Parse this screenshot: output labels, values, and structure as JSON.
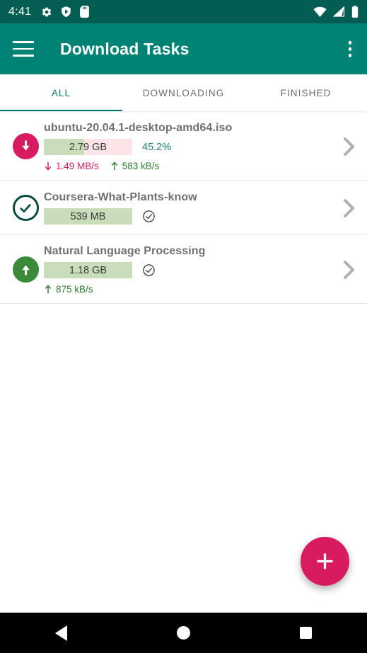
{
  "status_bar": {
    "clock": "4:41",
    "left_icons": [
      "gear-icon",
      "shield-play-icon",
      "sd-card-icon"
    ],
    "right_icons": [
      "wifi-icon",
      "cell-signal-icon",
      "battery-icon"
    ],
    "background": "#035D52"
  },
  "app_bar": {
    "menu_icon": "hamburger-menu-icon",
    "title": "Download Tasks",
    "overflow_icon": "more-vert-icon",
    "background": "#008375"
  },
  "tabs": {
    "active_index": 0,
    "active_color": "#00796B",
    "items": [
      {
        "label": "ALL"
      },
      {
        "label": "DOWNLOADING"
      },
      {
        "label": "FINISHED"
      }
    ]
  },
  "tasks": [
    {
      "name": "ubuntu-20.04.1-desktop-amd64.iso",
      "state_icon": "download-arrow-icon",
      "state_color": "#D81B60",
      "size": "2.79 GB",
      "percent_label": "45.2%",
      "percent_value": 45.2,
      "complete": false,
      "has_check": false,
      "download_speed": "1.49 MB/s",
      "upload_speed": "583 kB/s",
      "chevron_icon": "chevron-right-icon"
    },
    {
      "name": "Coursera-What-Plants-know",
      "state_icon": "check-circle-outline-icon",
      "state_color": "#0B4A42",
      "size": "539 MB",
      "percent_label": "",
      "percent_value": 100,
      "complete": true,
      "has_check": true,
      "download_speed": "",
      "upload_speed": "",
      "chevron_icon": "chevron-right-icon"
    },
    {
      "name": "Natural Language Processing",
      "state_icon": "upload-arrow-icon",
      "state_color": "#3A8A3A",
      "size": "1.18 GB",
      "percent_label": "",
      "percent_value": 100,
      "complete": true,
      "has_check": true,
      "download_speed": "",
      "upload_speed": "875 kB/s",
      "chevron_icon": "chevron-right-icon"
    }
  ],
  "fab": {
    "icon": "plus-icon",
    "color": "#D81B60"
  },
  "nav_bar": {
    "back": "back-triangle-icon",
    "home": "home-circle-icon",
    "recents": "recents-square-icon"
  }
}
